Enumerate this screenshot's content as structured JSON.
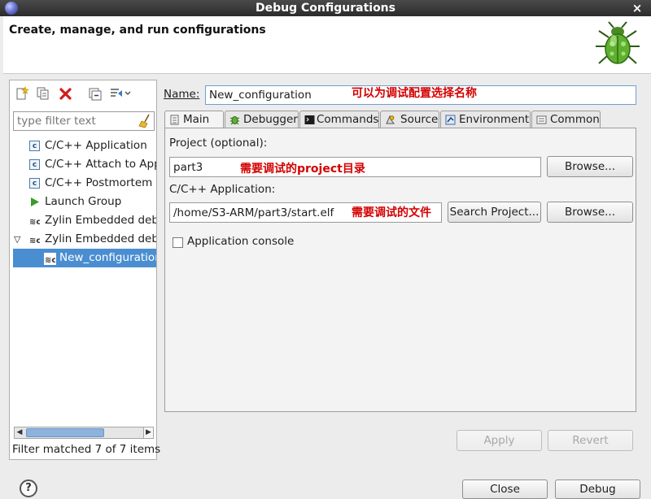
{
  "window": {
    "title": "Debug Configurations"
  },
  "header": {
    "title": "Create, manage, and run configurations"
  },
  "left_panel": {
    "filter_placeholder": "type filter text",
    "tree": [
      {
        "label": "C/C++ Application",
        "icon": "c-app-icon",
        "indent": 0,
        "expander": ""
      },
      {
        "label": "C/C++ Attach to Application",
        "icon": "c-app-icon",
        "indent": 0,
        "expander": ""
      },
      {
        "label": "C/C++ Postmortem Debugger",
        "icon": "c-app-icon",
        "indent": 0,
        "expander": ""
      },
      {
        "label": "Launch Group",
        "icon": "launch-group-icon",
        "indent": 0,
        "expander": ""
      },
      {
        "label": "Zylin Embedded debug (Cygwin)",
        "icon": "zylin-icon",
        "indent": 0,
        "expander": ""
      },
      {
        "label": "Zylin Embedded debug (Native)",
        "icon": "zylin-icon",
        "indent": 0,
        "expander": "▽"
      },
      {
        "label": "New_configuration",
        "icon": "zylin-icon",
        "indent": 1,
        "expander": "",
        "selected": true
      }
    ],
    "status": "Filter matched 7 of 7 items"
  },
  "main": {
    "name_label": "Name:",
    "name_value": "New_configuration",
    "name_note": "可以为调试配置选择名称",
    "tabs": [
      {
        "label": "Main",
        "icon": "main-tab-icon",
        "active": true
      },
      {
        "label": "Debugger",
        "icon": "debugger-tab-icon"
      },
      {
        "label": "Commands",
        "icon": "commands-tab-icon"
      },
      {
        "label": "Source",
        "icon": "source-tab-icon"
      },
      {
        "label": "Environment",
        "icon": "environment-tab-icon"
      },
      {
        "label": "Common",
        "icon": "common-tab-icon"
      }
    ],
    "project_label": "Project (optional):",
    "project_value": "part3",
    "project_note": "需要调试的project目录",
    "browse_label": "Browse...",
    "application_label": "C/C++ Application:",
    "application_value": "/home/S3-ARM/part3/start.elf",
    "application_note": "需要调试的文件",
    "search_project_label": "Search Project...",
    "browse2_label": "Browse...",
    "console_label": "Application console",
    "apply_label": "Apply",
    "revert_label": "Revert"
  },
  "footer": {
    "close_label": "Close",
    "debug_label": "Debug"
  }
}
